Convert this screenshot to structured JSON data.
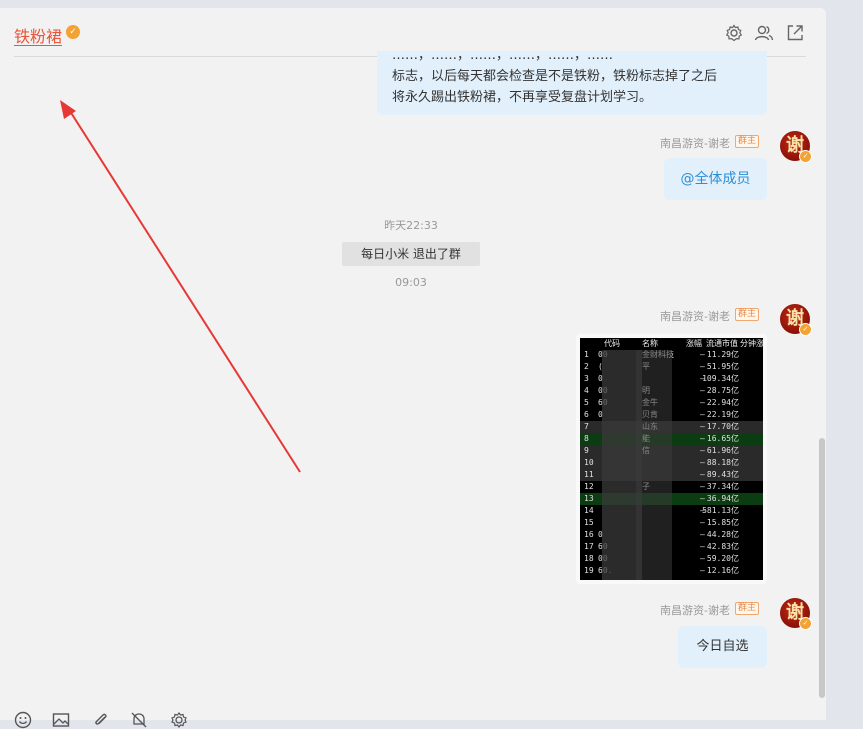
{
  "header": {
    "group_name": "铁粉裙",
    "icons": [
      "settings-icon",
      "members-icon",
      "popout-icon"
    ]
  },
  "messages": {
    "pinned_text": {
      "line_top": "……，……，……，……，……，……",
      "line1": "标志，以后每天都会检查是不是铁粉，铁粉标志掉了之后",
      "line2": "将永久踢出铁粉裙，不再享受复盘计划学习。"
    },
    "msg1": {
      "sender": "南昌游资-谢老",
      "role": "群主",
      "avatar_char": "谢",
      "text": "@全体成员"
    },
    "time1": "昨天22:33",
    "system_notice": "每日小米 退出了群",
    "time2": "09:03",
    "msg2": {
      "sender": "南昌游资-谢老",
      "role": "群主",
      "avatar_char": "谢"
    },
    "msg3": {
      "sender": "南昌游资-谢老",
      "role": "群主",
      "avatar_char": "谢",
      "text": "今日自选"
    }
  },
  "stock_table": {
    "headers": [
      "代码",
      "名称",
      "涨幅",
      "流通市值",
      "分钟涨"
    ],
    "rows": [
      {
        "n": "1",
        "code": "00",
        "name": "金财科技",
        "chg": "—",
        "mv": "11.29亿"
      },
      {
        "n": "2",
        "code": "(",
        "name": "平",
        "chg": "—",
        "mv": "51.95亿"
      },
      {
        "n": "3",
        "code": "0",
        "name": "",
        "chg": "—",
        "mv": "109.34亿"
      },
      {
        "n": "4",
        "code": "00",
        "name": "明",
        "chg": "—",
        "mv": "28.75亿"
      },
      {
        "n": "5",
        "code": "60",
        "name": "金牛",
        "chg": "—",
        "mv": "22.94亿"
      },
      {
        "n": "6",
        "code": "0",
        "name": "贝肯",
        "chg": "—",
        "mv": "22.19亿"
      },
      {
        "n": "7",
        "code": "",
        "name": "山东",
        "chg": "—",
        "mv": "17.70亿"
      },
      {
        "n": "8",
        "code": "",
        "name": "能",
        "chg": "—",
        "mv": "16.65亿"
      },
      {
        "n": "9",
        "code": "",
        "name": "信",
        "chg": "—",
        "mv": "61.96亿"
      },
      {
        "n": "10",
        "code": "",
        "name": "",
        "chg": "—",
        "mv": "88.18亿"
      },
      {
        "n": "11",
        "code": "",
        "name": "",
        "chg": "—",
        "mv": "89.43亿"
      },
      {
        "n": "12",
        "code": "",
        "name": "子",
        "chg": "—",
        "mv": "37.34亿"
      },
      {
        "n": "13",
        "code": "",
        "name": "",
        "chg": "—",
        "mv": "36.94亿"
      },
      {
        "n": "14",
        "code": "",
        "name": "",
        "chg": "—",
        "mv": "581.13亿"
      },
      {
        "n": "15",
        "code": "",
        "name": "",
        "chg": "—",
        "mv": "15.85亿"
      },
      {
        "n": "16",
        "code": "0",
        "name": "",
        "chg": "—",
        "mv": "44.28亿"
      },
      {
        "n": "17",
        "code": "60",
        "name": "",
        "chg": "—",
        "mv": "42.83亿"
      },
      {
        "n": "18",
        "code": "00",
        "name": "",
        "chg": "—",
        "mv": "59.20亿"
      },
      {
        "n": "19",
        "code": "60.",
        "name": "",
        "chg": "—",
        "mv": "12.16亿"
      }
    ]
  },
  "toolbar": {
    "icons": [
      "emoji-icon",
      "image-icon",
      "attachment-icon",
      "mute-icon",
      "settings-icon"
    ]
  },
  "colors": {
    "accent": "#e8563b",
    "bubble": "#e2f0fb",
    "mention": "#2c8fd6",
    "arrow": "#e53935"
  }
}
